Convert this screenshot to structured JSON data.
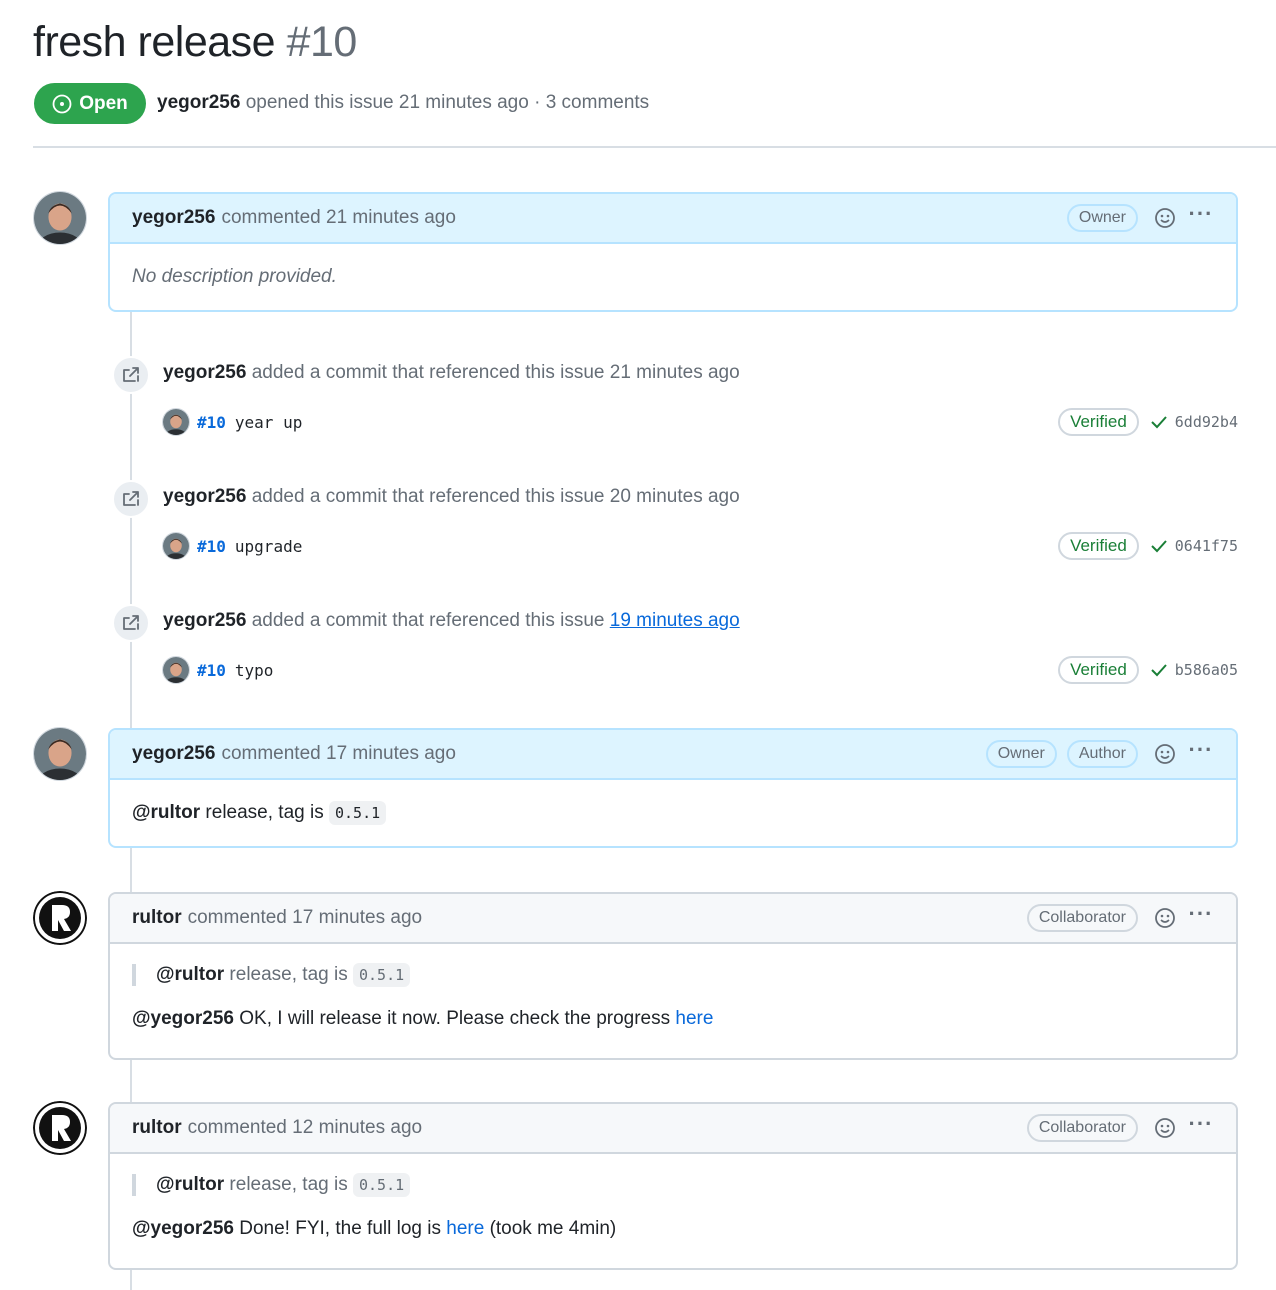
{
  "issue": {
    "title": "fresh release",
    "number": "#10",
    "state": "Open",
    "author": "yegor256",
    "meta_text": "opened this issue 21 minutes ago · 3 comments"
  },
  "colors": {
    "open_green": "#2da44e",
    "link_blue": "#0969da",
    "verified_green": "#1a7f37",
    "owner_header_bg": "#ddf4ff",
    "default_header_bg": "#f6f8fa"
  },
  "comments": [
    {
      "author": "yegor256",
      "action": "commented 21 minutes ago",
      "roles": [
        "Owner"
      ],
      "body_text": "No description provided."
    },
    {
      "author": "yegor256",
      "action": "commented 17 minutes ago",
      "roles": [
        "Owner",
        "Author"
      ],
      "mention": "@rultor",
      "body_text": "release, tag is",
      "code": "0.5.1"
    },
    {
      "author": "rultor",
      "action": "commented 17 minutes ago",
      "roles": [
        "Collaborator"
      ],
      "quote_mention": "@rultor",
      "quote_text": "release, tag is",
      "quote_code": "0.5.1",
      "reply_mention": "@yegor256",
      "reply_text": "OK, I will release it now. Please check the progress",
      "reply_link": "here"
    },
    {
      "author": "rultor",
      "action": "commented 12 minutes ago",
      "roles": [
        "Collaborator"
      ],
      "quote_mention": "@rultor",
      "quote_text": "release, tag is",
      "quote_code": "0.5.1",
      "reply_mention": "@yegor256",
      "reply_text": "Done! FYI, the full log is",
      "reply_link": "here",
      "reply_suffix": "(took me 4min)"
    }
  ],
  "events": [
    {
      "actor": "yegor256",
      "text": "added a commit that referenced this issue",
      "time": "21 minutes ago",
      "ref": "#10",
      "message": "year up",
      "badge": "Verified",
      "sha": "6dd92b4"
    },
    {
      "actor": "yegor256",
      "text": "added a commit that referenced this issue",
      "time": "20 minutes ago",
      "ref": "#10",
      "message": "upgrade",
      "badge": "Verified",
      "sha": "0641f75"
    },
    {
      "actor": "yegor256",
      "text": "added a commit that referenced this issue",
      "time": "19 minutes ago",
      "ref": "#10",
      "message": "typo",
      "badge": "Verified",
      "sha": "b586a05"
    }
  ],
  "icons": {
    "state": "issue-opened-icon",
    "event": "cross-reference-icon",
    "reaction": "smiley-icon",
    "menu": "kebab-horizontal-icon",
    "verified": "check-icon"
  }
}
